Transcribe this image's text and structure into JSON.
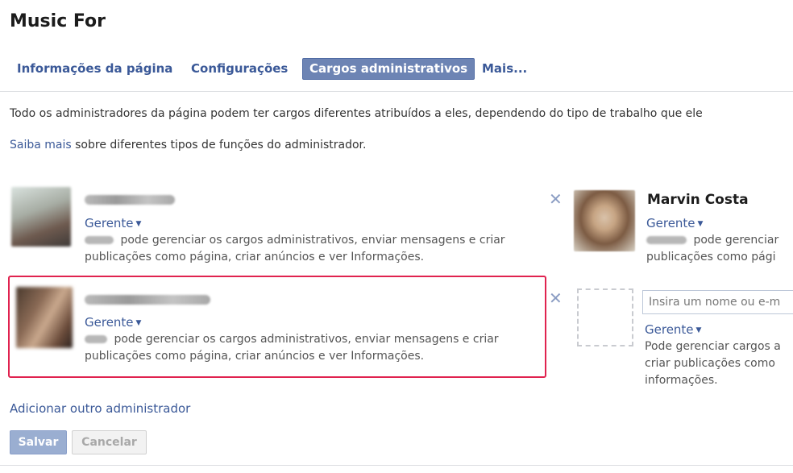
{
  "page": {
    "title": "Music For"
  },
  "tabs": [
    {
      "label": "Informações da página",
      "active": false
    },
    {
      "label": "Configurações",
      "active": false
    },
    {
      "label": "Cargos administrativos",
      "active": true
    },
    {
      "label": "Mais...",
      "active": false
    }
  ],
  "intro": {
    "line1": "Todo os administradores da página podem ter cargos diferentes atribuídos a eles, dependendo do tipo de trabalho que ele",
    "learn_more_link": "Saiba mais",
    "line2_rest": " sobre diferentes tipos de funções do administrador."
  },
  "admins": [
    {
      "name": "",
      "role": "Gerente",
      "desc_line1": " pode gerenciar os cargos administrativos, enviar mensagens e criar",
      "desc_line2": "publicações como página, criar anúncios e ver Informações.",
      "name_blurred": true
    },
    {
      "name": "Marvin Costa",
      "role": "Gerente",
      "desc_line1": " pode gerenciar",
      "desc_line2": "publicações como pági"
    },
    {
      "name": "",
      "role": "Gerente",
      "desc_line1": " pode gerenciar os cargos administrativos, enviar mensagens e criar",
      "desc_line2": "publicações como página, criar anúncios e ver Informações.",
      "name_blurred": true,
      "highlighted": true
    }
  ],
  "new_admin": {
    "placeholder": "Insira um nome ou e-m",
    "role": "Gerente",
    "desc_line1": "Pode gerenciar cargos a",
    "desc_line2": "criar publicações como",
    "desc_line3": "informações."
  },
  "add_admin_link": "Adicionar outro administrador",
  "buttons": {
    "save": "Salvar",
    "cancel": "Cancelar"
  },
  "icons": {
    "remove": "close-icon",
    "dropdown": "caret-down-icon"
  },
  "colors": {
    "link": "#3b5998",
    "active_tab": "#6d84b4",
    "highlight": "#e0224f",
    "remove_icon": "#8b9dc3"
  }
}
